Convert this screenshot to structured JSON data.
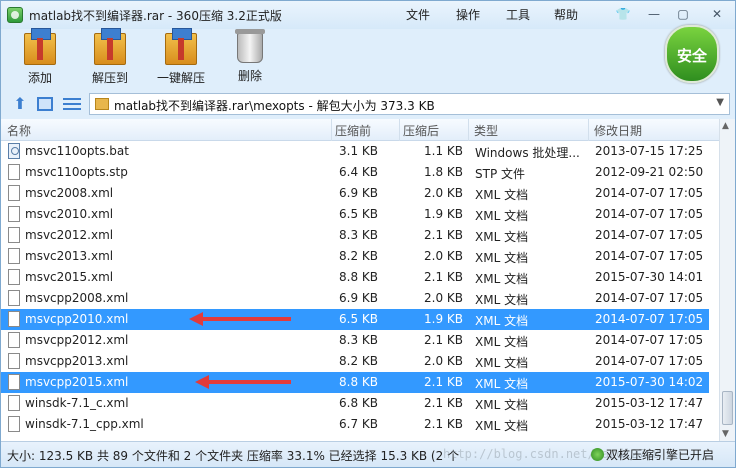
{
  "window": {
    "title": "matlab找不到编译器.rar - 360压缩 3.2正式版",
    "menus": [
      "文件",
      "操作",
      "工具",
      "帮助"
    ],
    "controls": {
      "skin": "👕",
      "minimize": "—",
      "maximize": "▢",
      "close": "✕"
    }
  },
  "toolbar": {
    "add_label": "添加",
    "extract_label": "解压到",
    "oneclick_label": "一键解压",
    "delete_label": "删除",
    "security_badge": "安全"
  },
  "addressbar": {
    "path": "matlab找不到编译器.rar\\mexopts - 解包大小为 373.3 KB",
    "dropdown": "▼"
  },
  "table": {
    "headers": {
      "name": "名称",
      "size": "压缩前",
      "packed": "压缩后",
      "type": "类型",
      "modified": "修改日期"
    },
    "rows": [
      {
        "name": "msvc110opts.bat",
        "size": "3.1 KB",
        "packed": "1.1 KB",
        "type": "Windows 批处理...",
        "date": "2013-07-15 17:25",
        "icon": "bat",
        "selected": false
      },
      {
        "name": "msvc110opts.stp",
        "size": "6.4 KB",
        "packed": "1.8 KB",
        "type": "STP 文件",
        "date": "2012-09-21 02:50",
        "icon": "file",
        "selected": false
      },
      {
        "name": "msvc2008.xml",
        "size": "6.9 KB",
        "packed": "2.0 KB",
        "type": "XML 文档",
        "date": "2014-07-07 17:05",
        "icon": "file",
        "selected": false
      },
      {
        "name": "msvc2010.xml",
        "size": "6.5 KB",
        "packed": "1.9 KB",
        "type": "XML 文档",
        "date": "2014-07-07 17:05",
        "icon": "file",
        "selected": false
      },
      {
        "name": "msvc2012.xml",
        "size": "8.3 KB",
        "packed": "2.1 KB",
        "type": "XML 文档",
        "date": "2014-07-07 17:05",
        "icon": "file",
        "selected": false
      },
      {
        "name": "msvc2013.xml",
        "size": "8.2 KB",
        "packed": "2.0 KB",
        "type": "XML 文档",
        "date": "2014-07-07 17:05",
        "icon": "file",
        "selected": false
      },
      {
        "name": "msvc2015.xml",
        "size": "8.8 KB",
        "packed": "2.1 KB",
        "type": "XML 文档",
        "date": "2015-07-30 14:01",
        "icon": "file",
        "selected": false
      },
      {
        "name": "msvcpp2008.xml",
        "size": "6.9 KB",
        "packed": "2.0 KB",
        "type": "XML 文档",
        "date": "2014-07-07 17:05",
        "icon": "file",
        "selected": false
      },
      {
        "name": "msvcpp2010.xml",
        "size": "6.5 KB",
        "packed": "1.9 KB",
        "type": "XML 文档",
        "date": "2014-07-07 17:05",
        "icon": "file",
        "selected": true
      },
      {
        "name": "msvcpp2012.xml",
        "size": "8.3 KB",
        "packed": "2.1 KB",
        "type": "XML 文档",
        "date": "2014-07-07 17:05",
        "icon": "file",
        "selected": false
      },
      {
        "name": "msvcpp2013.xml",
        "size": "8.2 KB",
        "packed": "2.0 KB",
        "type": "XML 文档",
        "date": "2014-07-07 17:05",
        "icon": "file",
        "selected": false
      },
      {
        "name": "msvcpp2015.xml",
        "size": "8.8 KB",
        "packed": "2.1 KB",
        "type": "XML 文档",
        "date": "2015-07-30 14:02",
        "icon": "file",
        "selected": true
      },
      {
        "name": "winsdk-7.1_c.xml",
        "size": "6.8 KB",
        "packed": "2.1 KB",
        "type": "XML 文档",
        "date": "2015-03-12 17:47",
        "icon": "file",
        "selected": false
      },
      {
        "name": "winsdk-7.1_cpp.xml",
        "size": "6.7 KB",
        "packed": "2.1 KB",
        "type": "XML 文档",
        "date": "2015-03-12 17:47",
        "icon": "file",
        "selected": false
      }
    ]
  },
  "status": {
    "summary": "大小: 123.5 KB 共 89 个文件和 2 个文件夹 压缩率 33.1% 已经选择 15.3 KB (2 个",
    "watermark": "http://blog.csdn.net/hardi2768",
    "engine": "双核压缩引擎已开启"
  },
  "colors": {
    "selection": "#3399ff",
    "annotation_arrow": "#e23b3b",
    "badge": "#2f8e1f"
  }
}
